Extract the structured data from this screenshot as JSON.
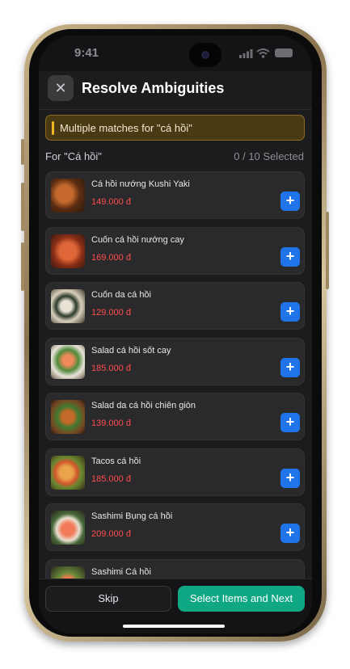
{
  "status_bar": {
    "time": "9:41"
  },
  "header": {
    "title": "Resolve Ambiguities",
    "close_icon": "close-icon"
  },
  "banner": {
    "text": "Multiple matches for \"cá hồi\"",
    "accent": "#f1b823"
  },
  "section": {
    "label": "For \"Cá hồi\"",
    "count": "0 / 10  Selected"
  },
  "items": [
    {
      "name": "Cá hồi nướng Kushi Yaki",
      "price": "149.000 đ"
    },
    {
      "name": "Cuốn cá hồi nướng cay",
      "price": "169.000 đ"
    },
    {
      "name": "Cuốn da cá hồi",
      "price": "129.000 đ"
    },
    {
      "name": "Salad cá hồi sốt cay",
      "price": "185.000 đ"
    },
    {
      "name": "Salad da cá hồi chiên giòn",
      "price": "139.000 đ"
    },
    {
      "name": "Tacos cá hồi",
      "price": "185.000 đ"
    },
    {
      "name": "Sashimi Bụng cá hồi",
      "price": "209.000 đ"
    },
    {
      "name": "Sashimi Cá hồi",
      "price": ""
    }
  ],
  "add_label": "+",
  "footer": {
    "skip_label": "Skip",
    "next_label": "Select Items and Next"
  },
  "colors": {
    "accent_blue": "#1e74e8",
    "accent_green": "#10a884",
    "price_red": "#ff4d4d"
  }
}
